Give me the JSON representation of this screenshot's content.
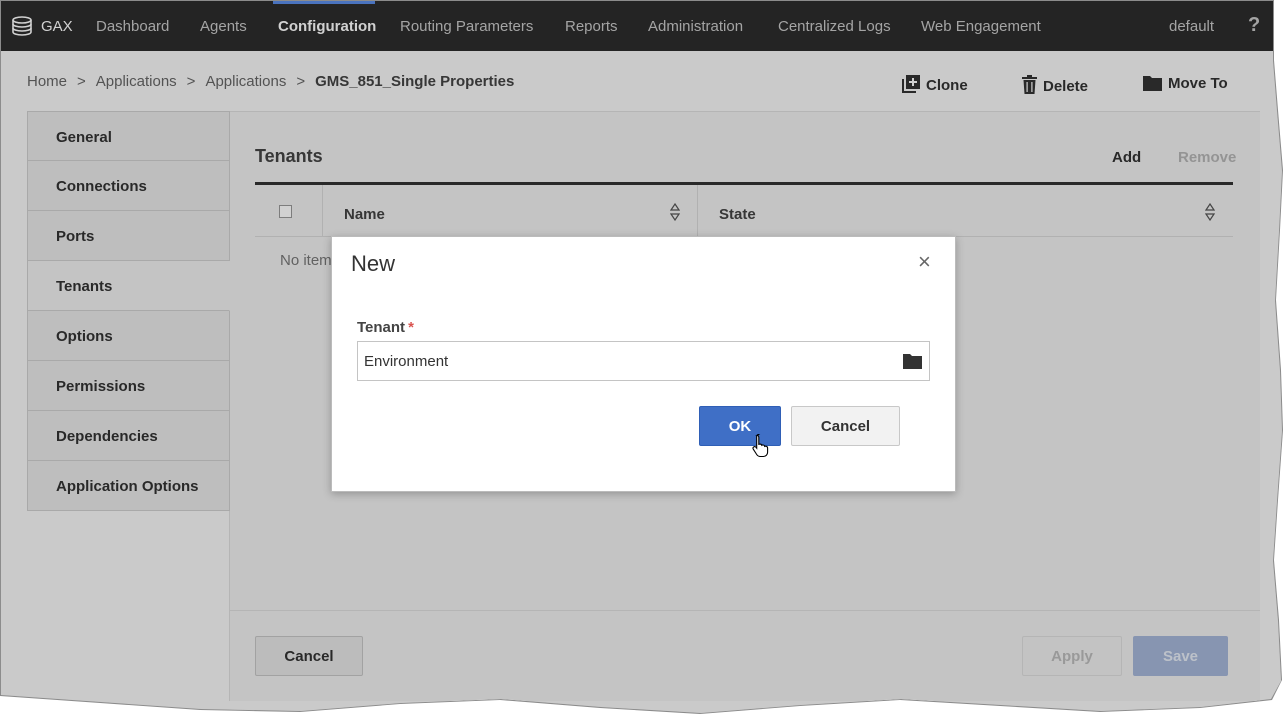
{
  "nav": {
    "brand": "GAX",
    "items": [
      "Dashboard",
      "Agents",
      "Configuration",
      "Routing Parameters",
      "Reports",
      "Administration",
      "Centralized Logs",
      "Web Engagement"
    ],
    "active": "Configuration",
    "user": "default",
    "help": "?"
  },
  "breadcrumb": {
    "items": [
      "Home",
      "Applications",
      "Applications"
    ],
    "current": "GMS_851_Single Properties",
    "separator": ">"
  },
  "actions": {
    "clone": "Clone",
    "delete": "Delete",
    "move_to": "Move To"
  },
  "tabs": [
    "General",
    "Connections",
    "Ports",
    "Tenants",
    "Options",
    "Permissions",
    "Dependencies",
    "Application Options"
  ],
  "active_tab": "Tenants",
  "section": {
    "title": "Tenants",
    "add": "Add",
    "remove": "Remove",
    "columns": [
      "Name",
      "State"
    ],
    "empty_text": "No item"
  },
  "footer": {
    "cancel": "Cancel",
    "apply": "Apply",
    "save": "Save"
  },
  "modal": {
    "title": "New",
    "close": "×",
    "field_label": "Tenant",
    "required_mark": "*",
    "field_value": "Environment",
    "ok": "OK",
    "cancel": "Cancel"
  },
  "colors": {
    "nav_bg": "#2d2d2d",
    "accent": "#3f6fc6",
    "required": "#d9534f"
  },
  "icons": [
    "database-icon",
    "help-icon",
    "clone-icon",
    "trash-icon",
    "folder-icon",
    "sort-icon",
    "close-icon",
    "browse-folder-icon",
    "hand-cursor-icon"
  ]
}
